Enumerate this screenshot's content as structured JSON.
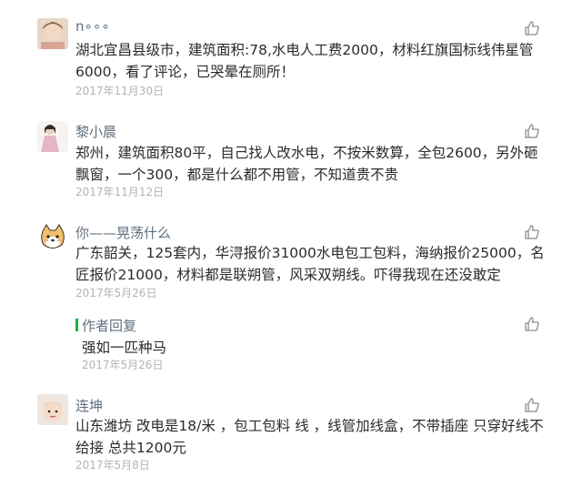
{
  "comments": [
    {
      "author": "n∘∘∘",
      "text": "湖北宜昌县级市，建筑面积:78,水电人工费2000，材料红旗国标线伟星管6000，看了评论，已哭晕在厕所！",
      "date": "2017年11月30日",
      "avatar": "avatar-photo-child-icon"
    },
    {
      "author": "黎小晨",
      "text": "郑州，建筑面积80平，自己找人改水电，不按米数算，全包2600，另外砸飘窗，一个300，都是什么都不用管，不知道贵不贵",
      "date": "2017年11月12日",
      "avatar": "avatar-photo-woman-icon"
    },
    {
      "author": "你——晃荡什么",
      "text": "广东韶关，125套内，华浔报价31000水电包工包料，海纳报价25000，名匠报价21000，材料都是联朔管，风采双朔线。吓得我现在还没敢定",
      "date": "2017年5月26日",
      "avatar": "avatar-shiba-dog-icon"
    },
    {
      "author": "连坤",
      "text": "山东潍坊 改电是18/米 ，包工包料 线 ，线管加线盒，不带插座 只穿好线不给接 总共1200元",
      "date": "2017年5月8日",
      "avatar": "avatar-photo-baby-icon"
    }
  ],
  "reply": {
    "label": "作者回复",
    "text": "强如一匹种马",
    "date": "2017年5月26日"
  },
  "colors": {
    "accent": "#21b23e",
    "name": "#5f6f7f",
    "date": "#b3b3b3",
    "text": "#2b2b2b"
  }
}
